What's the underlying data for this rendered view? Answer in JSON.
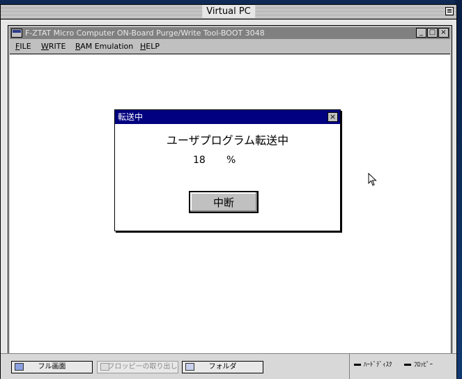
{
  "vpc": {
    "title": "Virtual PC"
  },
  "app": {
    "title": "F-ZTAT Micro Computer ON-Board Purge/Write Tool-BOOT 3048",
    "controls": {
      "minimize": "_",
      "maximize": "□",
      "close": "×"
    },
    "menu": [
      {
        "key": "F",
        "rest": "ILE"
      },
      {
        "key": "W",
        "rest": "RITE"
      },
      {
        "key": "R",
        "rest": "AM Emulation"
      },
      {
        "key": "H",
        "rest": "ELP"
      }
    ]
  },
  "dialog": {
    "title": "転送中",
    "close": "×",
    "message": "ユーザプログラム転送中",
    "progress_value": "18",
    "progress_unit": "%",
    "abort_label": "中断"
  },
  "statusbar": {
    "buttons": [
      {
        "label": "フル画面",
        "enabled": true,
        "icon": "screen-icon"
      },
      {
        "label": "フロッピーの取り出し",
        "enabled": false,
        "icon": "floppy-icon"
      },
      {
        "label": "フォルダ",
        "enabled": true,
        "icon": "folder-icon"
      }
    ],
    "indicators": [
      "ﾊｰﾄﾞﾃﾞｨｽｸ",
      "ﾌﾛｯﾋﾟｰ"
    ]
  }
}
